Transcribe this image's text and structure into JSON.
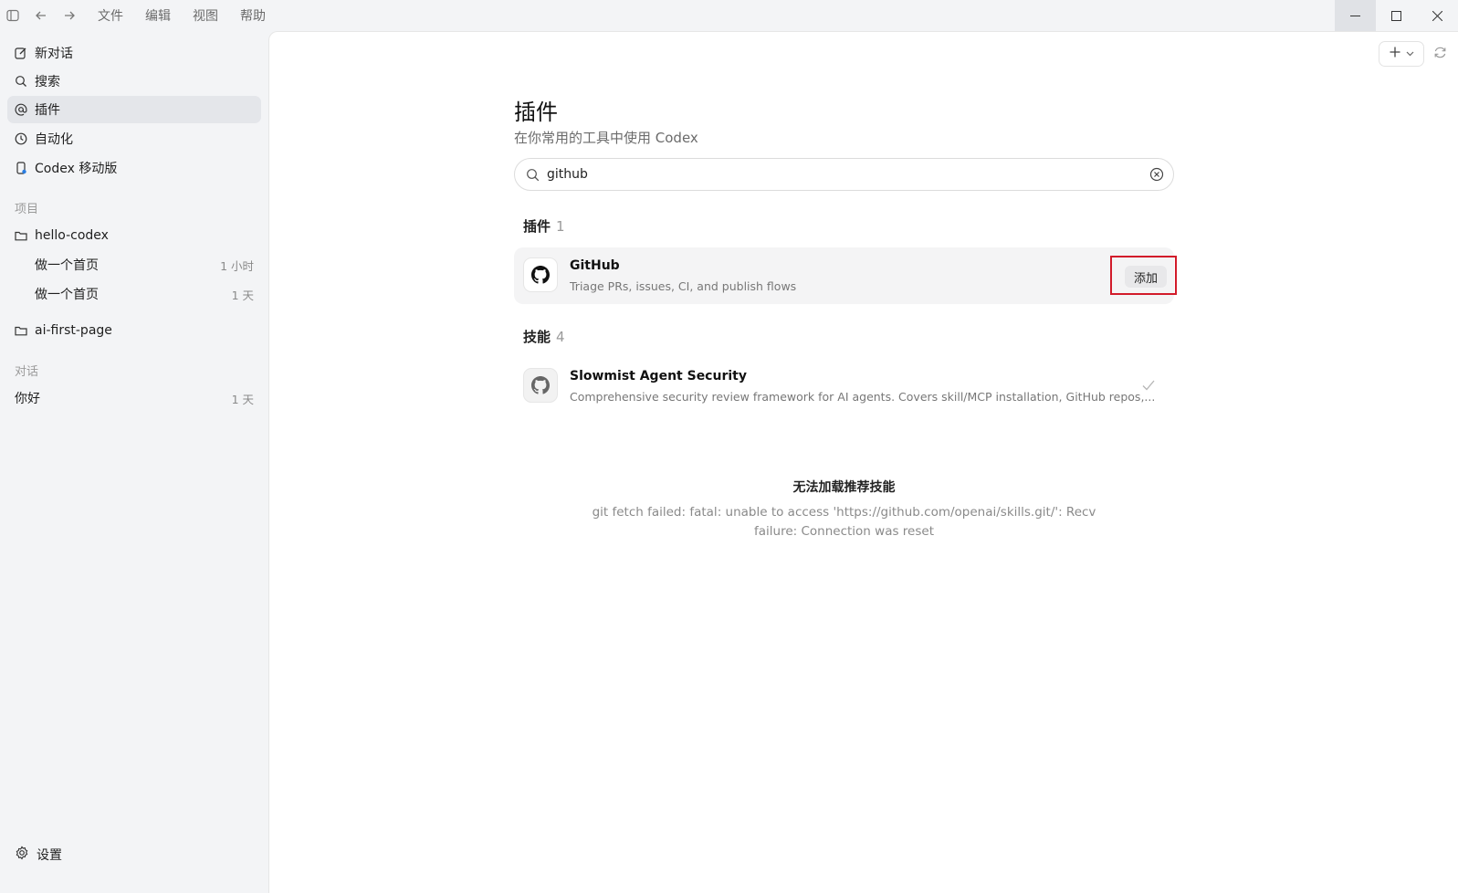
{
  "menu": [
    "文件",
    "编辑",
    "视图",
    "帮助"
  ],
  "sidebar": {
    "nav": [
      {
        "label": "新对话",
        "icon": "edit-icon"
      },
      {
        "label": "搜索",
        "icon": "search-icon"
      },
      {
        "label": "插件",
        "icon": "at-icon"
      },
      {
        "label": "自动化",
        "icon": "clock-icon"
      },
      {
        "label": "Codex 移动版",
        "icon": "mobile-icon"
      }
    ],
    "projects_label": "项目",
    "projects": [
      {
        "name": "hello-codex",
        "threads": [
          {
            "title": "做一个首页",
            "time": "1 小时"
          },
          {
            "title": "做一个首页",
            "time": "1 天"
          }
        ]
      },
      {
        "name": "ai-first-page",
        "threads": []
      }
    ],
    "chats_label": "对话",
    "chats": [
      {
        "title": "你好",
        "time": "1 天"
      }
    ],
    "settings_label": "设置"
  },
  "main": {
    "title": "插件",
    "subtitle": "在你常用的工具中使用 Codex",
    "search_value": "github",
    "plugins_group": {
      "label": "插件",
      "count": "1"
    },
    "plugin": {
      "name": "GitHub",
      "description": "Triage PRs, issues, CI, and publish flows",
      "add_label": "添加"
    },
    "skills_group": {
      "label": "技能",
      "count": "4"
    },
    "skill": {
      "name": "Slowmist Agent Security",
      "description": "Comprehensive security review framework for AI agents. Covers skill/MCP installation, GitHub repos,..."
    },
    "error_title": "无法加载推荐技能",
    "error_message": "git fetch failed: fatal: unable to access 'https://github.com/openai/skills.git/': Recv failure: Connection was reset"
  }
}
